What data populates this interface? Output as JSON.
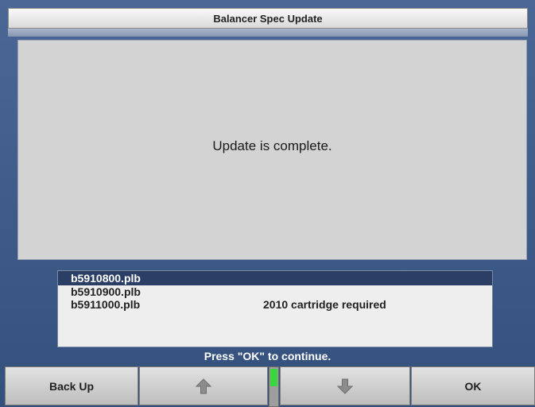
{
  "window": {
    "title": "Balancer Spec Update"
  },
  "message": {
    "text": "Update is complete."
  },
  "files": [
    {
      "name": "b5910800.plb",
      "note": "",
      "selected": true
    },
    {
      "name": "b5910900.plb",
      "note": "",
      "selected": false
    },
    {
      "name": "b5911000.plb",
      "note": "2010 cartridge required",
      "selected": false
    }
  ],
  "prompt": "Press \"OK\" to continue.",
  "buttons": {
    "back_label": "Back Up",
    "up_icon": "arrow-up-icon",
    "down_icon": "arrow-down-icon",
    "ok_label": "OK"
  },
  "colors": {
    "accent_bg": "#3e5a86",
    "selected_row": "#2b3f66",
    "scroll_indicator": "#3ad640"
  }
}
